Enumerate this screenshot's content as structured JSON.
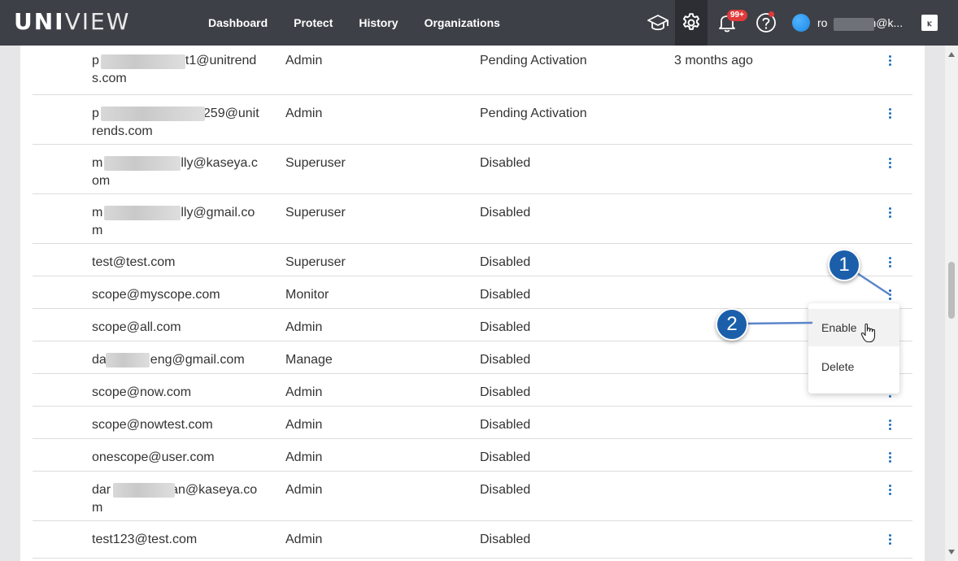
{
  "header": {
    "logo_bold": "UNI",
    "logo_light": "VIEW",
    "nav": [
      "Dashboard",
      "Protect",
      "History",
      "Organizations"
    ],
    "notification_badge": "99+",
    "user_email_start": "ro",
    "user_email_end": "n@k...",
    "kaseya_glyph": "ⲕ"
  },
  "rows": [
    {
      "email_a": "p",
      "email_b": "t1@unitrends.com",
      "role": "Admin",
      "status": "Pending Activation",
      "last": "3 months ago"
    },
    {
      "email_a": "p",
      "email_b": "259@unitrends.com",
      "role": "Admin",
      "status": "Pending Activation",
      "last": ""
    },
    {
      "email_a": "m",
      "email_b": "lly@kaseya.com",
      "role": "Superuser",
      "status": "Disabled",
      "last": ""
    },
    {
      "email_a": "m",
      "email_b": "lly@gmail.com",
      "role": "Superuser",
      "status": "Disabled",
      "last": ""
    },
    {
      "email_a": "test@test.com",
      "email_b": "",
      "role": "Superuser",
      "status": "Disabled",
      "last": ""
    },
    {
      "email_a": "scope@myscope.com",
      "email_b": "",
      "role": "Monitor",
      "status": "Disabled",
      "last": ""
    },
    {
      "email_a": "scope@all.com",
      "email_b": "",
      "role": "Admin",
      "status": "Disabled",
      "last": ""
    },
    {
      "email_a": "da",
      "email_b": "eng@gmail.com",
      "role": "Manage",
      "status": "Disabled",
      "last": ""
    },
    {
      "email_a": "scope@now.com",
      "email_b": "",
      "role": "Admin",
      "status": "Disabled",
      "last": ""
    },
    {
      "email_a": "scope@nowtest.com",
      "email_b": "",
      "role": "Admin",
      "status": "Disabled",
      "last": ""
    },
    {
      "email_a": "onescope@user.com",
      "email_b": "",
      "role": "Admin",
      "status": "Disabled",
      "last": ""
    },
    {
      "email_a": "dar",
      "email_b": "an@kaseya.com",
      "role": "Admin",
      "status": "Disabled",
      "last": ""
    },
    {
      "email_a": "test123@test.com",
      "email_b": "",
      "role": "Admin",
      "status": "Disabled",
      "last": ""
    }
  ],
  "menu": {
    "enable": "Enable",
    "delete": "Delete"
  },
  "callouts": {
    "one": "1",
    "two": "2"
  },
  "colors": {
    "topbar": "#3d4046",
    "accent": "#1f6fc1",
    "callout": "#1b5fab",
    "badge": "#e03a3a"
  }
}
